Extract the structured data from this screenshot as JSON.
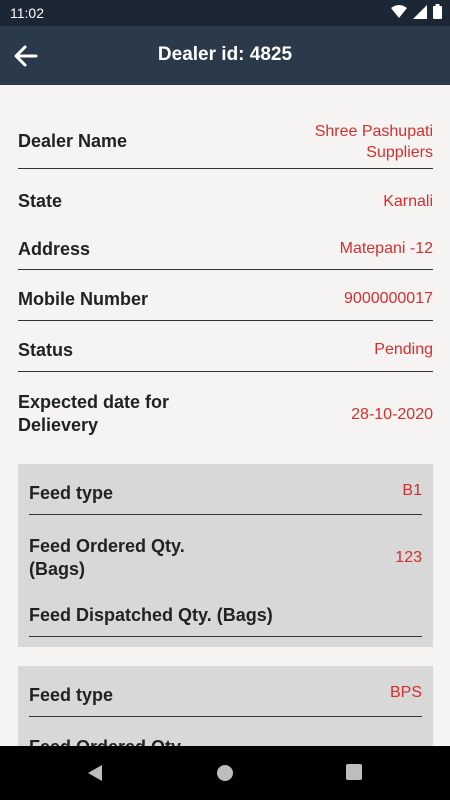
{
  "status_bar": {
    "time": "11:02"
  },
  "header": {
    "title": "Dealer id: 4825"
  },
  "details": [
    {
      "label": "Dealer Name",
      "value": "Shree Pashupati\nSuppliers"
    },
    {
      "label": "State",
      "value": "Karnali"
    },
    {
      "label": "Address",
      "value": "Matepani -12"
    },
    {
      "label": "Mobile Number",
      "value": "9000000017"
    },
    {
      "label": "Status",
      "value": "Pending"
    },
    {
      "label": "Expected date for\nDelievery",
      "value": "28-10-2020"
    }
  ],
  "feeds": [
    {
      "type_label": "Feed type",
      "type_value": "B1",
      "ordered_label": "Feed Ordered Qty.\n(Bags)",
      "ordered_value": "123",
      "dispatched_label": "Feed Dispatched Qty. (Bags)",
      "dispatched_value": ""
    },
    {
      "type_label": "Feed type",
      "type_value": "BPS",
      "ordered_label": "Feed Ordered Qty.",
      "ordered_value": ""
    }
  ],
  "colors": {
    "appbar": "#2b3a4b",
    "value_text": "#d32f2f",
    "card_bg": "#d8d8d8"
  }
}
